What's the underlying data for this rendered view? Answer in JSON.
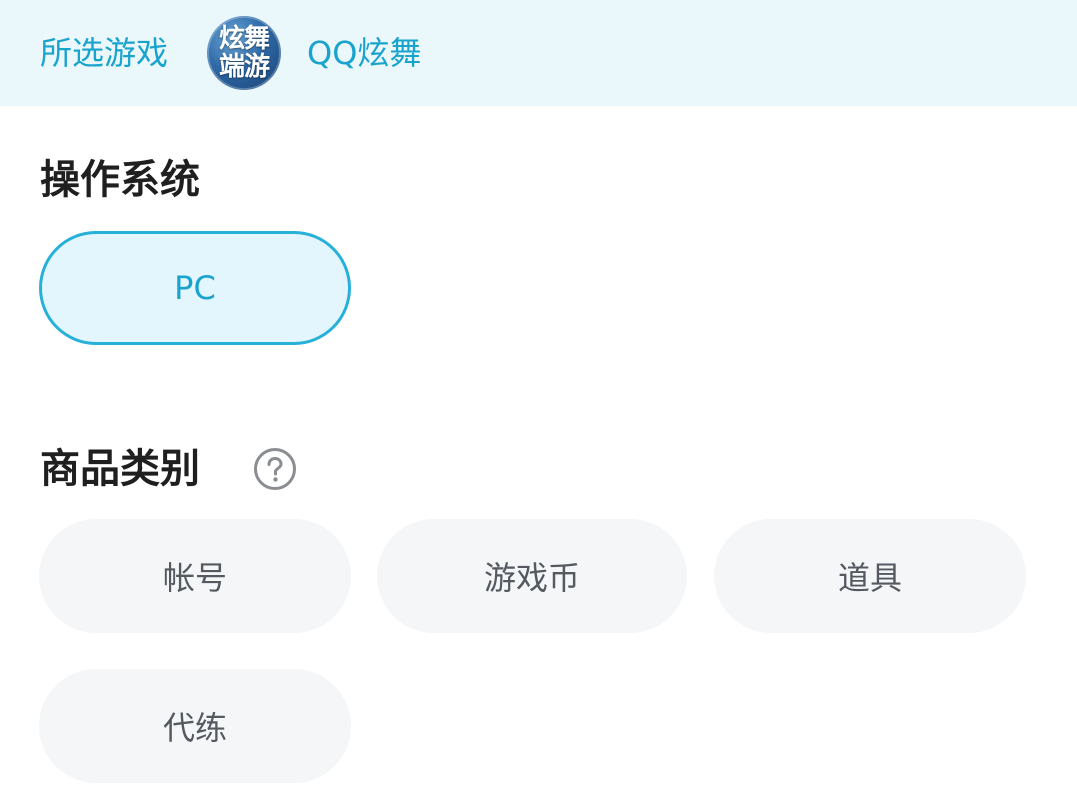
{
  "header": {
    "label": "所选游戏",
    "game_logo_text": [
      "炫舞",
      "端游"
    ],
    "game_name": "QQ炫舞"
  },
  "os_section": {
    "title": "操作系统",
    "options": [
      {
        "label": "PC",
        "selected": true
      }
    ]
  },
  "category_section": {
    "title": "商品类别",
    "help_icon": "question-circle-icon",
    "options": [
      {
        "label": "帐号",
        "selected": false
      },
      {
        "label": "游戏币",
        "selected": false
      },
      {
        "label": "道具",
        "selected": false
      },
      {
        "label": "代练",
        "selected": false
      }
    ]
  },
  "colors": {
    "accent": "#1aa3cc",
    "header_bg": "#eaf8fc",
    "selected_border": "#27b1d8",
    "selected_bg": "#e3f6fd",
    "chip_bg": "#f4f6f8",
    "title_text": "#1f1f1f",
    "chip_text": "#555a60"
  }
}
